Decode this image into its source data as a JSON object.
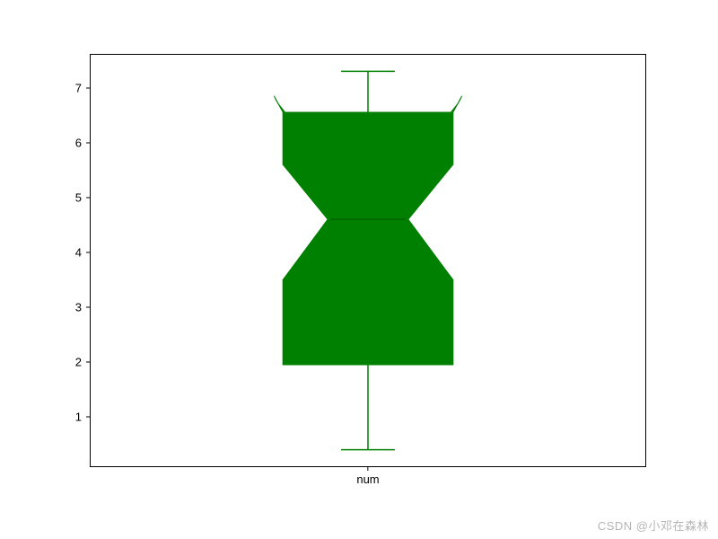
{
  "chart_data": {
    "type": "boxplot",
    "categories": [
      "num"
    ],
    "series": [
      {
        "name": "num",
        "min": 0.4,
        "q1": 1.95,
        "median": 4.6,
        "q3": 6.55,
        "max": 7.3,
        "notch_lo": 3.5,
        "notch_hi": 5.6
      }
    ],
    "xlabel": "",
    "ylabel": "",
    "ylim": [
      0.1,
      7.6
    ],
    "yticks": [
      1,
      2,
      3,
      4,
      5,
      6,
      7
    ],
    "notched": true,
    "box_color": "#008000"
  },
  "x_category_label": "num",
  "ytick_labels": {
    "t1": "1",
    "t2": "2",
    "t3": "3",
    "t4": "4",
    "t5": "5",
    "t6": "6",
    "t7": "7"
  },
  "watermark": "CSDN @小邓在森林"
}
